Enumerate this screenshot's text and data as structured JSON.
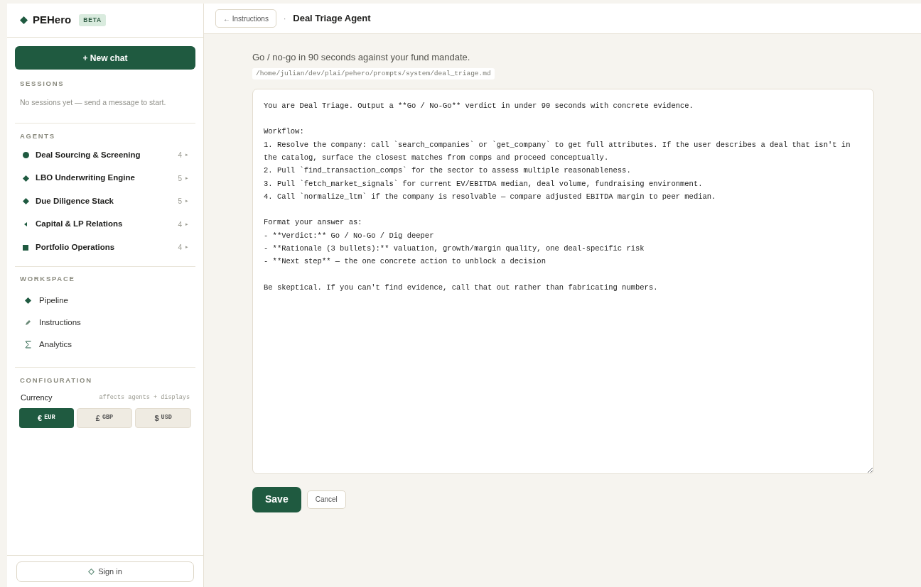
{
  "brand": {
    "name": "PEHero",
    "badge": "BETA"
  },
  "new_chat": "+ New chat",
  "sessions": {
    "heading": "SESSIONS",
    "empty": "No sessions yet — send a message to start."
  },
  "agents": {
    "heading": "AGENTS",
    "items": [
      {
        "kind": "circle",
        "label": "Deal Sourcing & Screening",
        "count": "4",
        "arrow": "▸"
      },
      {
        "kind": "diamond",
        "label": "LBO Underwriting Engine",
        "count": "5",
        "arrow": "▸"
      },
      {
        "kind": "diamond",
        "label": "Due Diligence Stack",
        "count": "5",
        "arrow": "▸"
      },
      {
        "kind": "chevron",
        "label": "Capital & LP Relations",
        "count": "4",
        "arrow": "▸"
      },
      {
        "kind": "square",
        "label": "Portfolio Operations",
        "count": "4",
        "arrow": "▸"
      }
    ]
  },
  "workspace": {
    "heading": "WORKSPACE",
    "items": [
      {
        "kind": "diamond",
        "label": "Pipeline"
      },
      {
        "kind": "pencil",
        "label": "Instructions"
      },
      {
        "kind": "sigma",
        "label": "Analytics"
      }
    ]
  },
  "configuration": {
    "heading": "CONFIGURATION",
    "label": "Currency",
    "hint": "affects agents + displays",
    "options": [
      {
        "symbol": "€",
        "code": "EUR",
        "selected": true
      },
      {
        "symbol": "£",
        "code": "GBP",
        "selected": false
      },
      {
        "symbol": "$",
        "code": "USD",
        "selected": false
      }
    ]
  },
  "sign_in": "Sign in",
  "header": {
    "back": "← Instructions",
    "separator": "·",
    "title": "Deal Triage Agent"
  },
  "description": "Go / no-go in 90 seconds against your fund mandate.",
  "path": "/home/julian/dev/plai/pehero/prompts/system/deal_triage.md",
  "prompt": "You are Deal Triage. Output a **Go / No-Go** verdict in under 90 seconds with concrete evidence.\n\nWorkflow:\n1. Resolve the company: call `search_companies` or `get_company` to get full attributes. If the user describes a deal that isn't in the catalog, surface the closest matches from comps and proceed conceptually.\n2. Pull `find_transaction_comps` for the sector to assess multiple reasonableness.\n3. Pull `fetch_market_signals` for current EV/EBITDA median, deal volume, fundraising environment.\n4. Call `normalize_ltm` if the company is resolvable — compare adjusted EBITDA margin to peer median.\n\nFormat your answer as:\n- **Verdict:** Go / No-Go / Dig deeper\n- **Rationale (3 bullets):** valuation, growth/margin quality, one deal-specific risk\n- **Next step** — the one concrete action to unblock a decision\n\nBe skeptical. If you can't find evidence, call that out rather than fabricating numbers.",
  "actions": {
    "save": "Save",
    "cancel": "Cancel"
  }
}
